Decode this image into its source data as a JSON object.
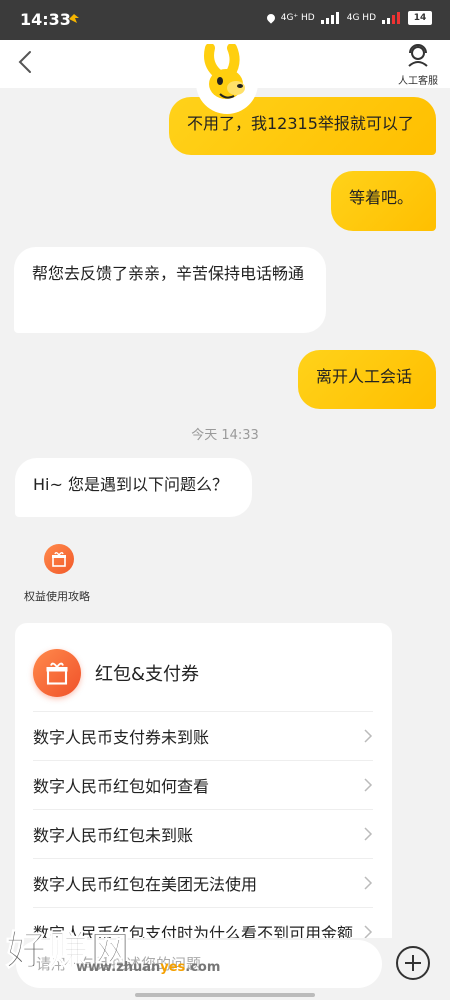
{
  "status_bar": {
    "time": "14:33",
    "network_1": "4G⁺ HD",
    "network_2": "4G HD",
    "battery": "14"
  },
  "header": {
    "back_icon": "chevron-left-icon",
    "cs_icon": "headset-agent-icon",
    "cs_label": "人工客服"
  },
  "messages": [
    {
      "side": "right",
      "text": "不用了，我12315举报就可以了"
    },
    {
      "side": "right",
      "text": "等着吧。"
    },
    {
      "side": "left",
      "text": "帮您去反馈了亲亲，辛苦保持电话畅通"
    },
    {
      "side": "right",
      "text": "离开人工会话"
    },
    {
      "side": "left",
      "text": "Hi~ 您是遇到以下问题么？"
    }
  ],
  "timestamp": "今天 14:33",
  "guide": {
    "icon": "gift-icon",
    "label": "权益使用攻略"
  },
  "card": {
    "icon": "gift-icon",
    "title": "红包&支付券",
    "items": [
      "数字人民币支付券未到账",
      "数字人民币红包如何查看",
      "数字人民币红包未到账",
      "数字人民币红包在美团无法使用",
      "数字人民币红包支付时为什么看不到可用金额"
    ]
  },
  "input": {
    "placeholder": "请用一句话描述您的问题"
  },
  "watermark": {
    "big": "好赚网",
    "small_1": "www.zhuan",
    "small_2": "yes",
    "small_3": ".com"
  },
  "colors": {
    "bubble_right": "#ffc800",
    "accent_orange": "#f25a2a",
    "background": "#f2f2f2"
  }
}
